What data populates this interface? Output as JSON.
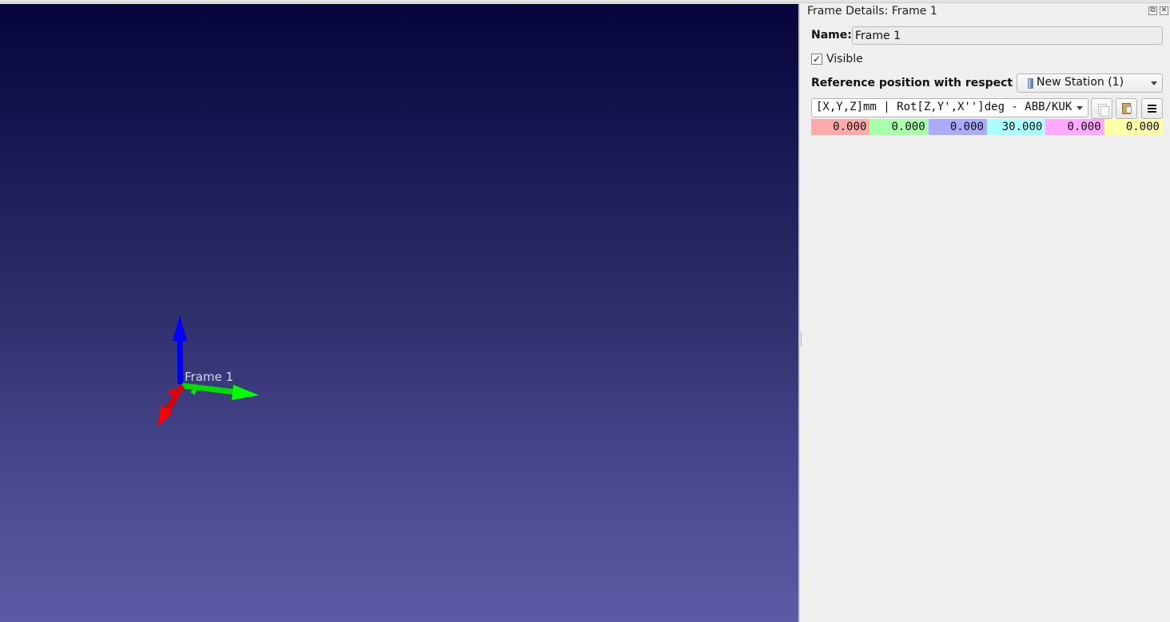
{
  "viewport": {
    "frame_label": "Frame 1",
    "background_top": "#05053a",
    "background_bottom": "#5c5ca6",
    "axis_colors": {
      "x": "#ff0000",
      "y": "#00ff00",
      "z": "#0000ff"
    }
  },
  "panel": {
    "title": "Frame Details: Frame 1",
    "name_label": "Name:",
    "name_value": "Frame 1",
    "visible_label": "Visible",
    "visible_checked": true,
    "visible_check_glyph": "✓",
    "reference_label": "Reference position with respect to:",
    "reference_value": "New Station (1)",
    "format_value": "[X,Y,Z]mm | Rot[Z,Y',X'']deg - ABB/KUKA",
    "buttons": [
      "copy-icon",
      "paste-icon",
      "menu-icon"
    ],
    "pose_values": [
      {
        "value": "0.000",
        "color": "#ffaaaa"
      },
      {
        "value": "0.000",
        "color": "#aaffaa"
      },
      {
        "value": "0.000",
        "color": "#aaaaff"
      },
      {
        "value": "30.000",
        "color": "#aaffff"
      },
      {
        "value": "0.000",
        "color": "#ffaaff"
      },
      {
        "value": "0.000",
        "color": "#ffffaa"
      }
    ]
  }
}
